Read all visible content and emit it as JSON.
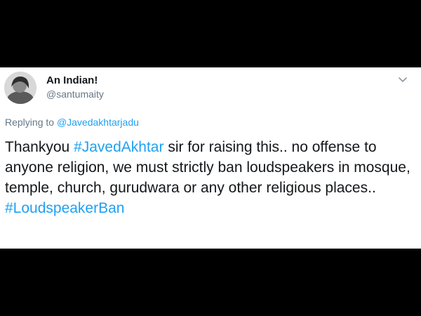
{
  "tweet": {
    "author": {
      "name": "An Indian!",
      "handle": "@santumaity"
    },
    "reply": {
      "prefix": "Replying to",
      "target": "@Javedakhtarjadu"
    },
    "body": {
      "part1": "Thankyou ",
      "hashtag1": "#JavedAkhtar",
      "part2": " sir for raising this.. no offense to anyone religion, we must strictly ban loudspeakers in mosque, temple, church, gurudwara or any other religious places..",
      "hashtag2": "#LoudspeakerBan"
    },
    "menu_icon": "chevron-down-icon",
    "colors": {
      "link": "#1da1f2",
      "secondary_text": "#657786",
      "primary_text": "#14171a",
      "background": "#ffffff",
      "letterbox": "#000000"
    }
  }
}
